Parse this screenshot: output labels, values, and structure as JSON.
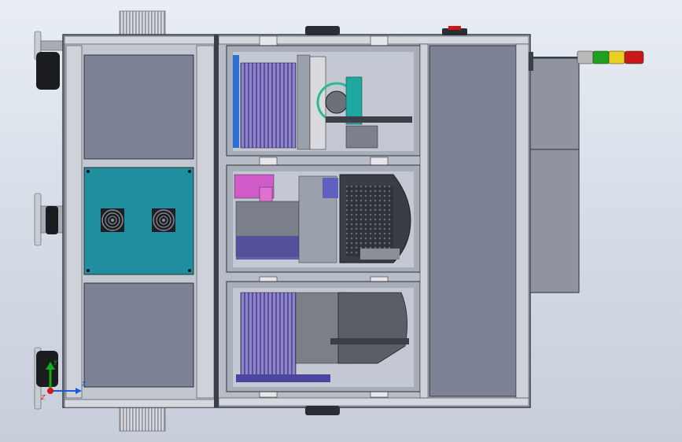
{
  "viewport": {
    "background_top": "#e9eef5",
    "background_bottom": "#c7ceda"
  },
  "machine": {
    "frame_color": "#9aa0ab",
    "frame_dark": "#3b3f47",
    "panel_color": "#7d8296",
    "fan_panel_color": "#1f8fa0",
    "fan_count": 2,
    "compartments": 3
  },
  "stack_light": {
    "colors": [
      "#b9b9b9",
      "#20a020",
      "#e8d020",
      "#c81818"
    ]
  },
  "triad": {
    "x_label": "X",
    "y_label": "Y",
    "z_label": "Z",
    "x_color": "#1a5bd6",
    "y_color": "#18a818",
    "z_color": "#d41818"
  }
}
